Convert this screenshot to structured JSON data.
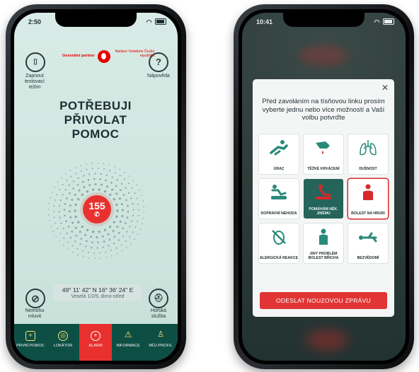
{
  "left_phone": {
    "status_time": "2:50",
    "test_mode_label": "Zapnout testovací režim",
    "help_icon_glyph": "?",
    "help_label": "Nápověda",
    "partner_text": "Generální partner",
    "partner_org": "Nadace Vodafone Česká republika",
    "headline": "POTŘEBUJI PŘIVOLAT POMOC",
    "call_number": "155",
    "coordinates": "49° 11' 42\" N 16° 36' 24\" E",
    "address": "Veselá 1/2/6, Brno-střed",
    "mute_label": "Nemohu mluvit",
    "mountain_label": "Horská služba",
    "tabs": [
      {
        "label": "PRVNÍ POMOC",
        "icon": "first-aid-kit-icon"
      },
      {
        "label": "LOKÁTOR",
        "icon": "locator-icon"
      },
      {
        "label": "ALARM",
        "icon": "alarm-icon"
      },
      {
        "label": "INFORMACE",
        "icon": "warning-icon"
      },
      {
        "label": "MŮJ PROFIL",
        "icon": "profile-icon"
      }
    ],
    "colors": {
      "accent": "#e8312f",
      "tabbar": "#0e4f45"
    }
  },
  "right_phone": {
    "status_time": "10:41",
    "prompt": "Před zavoláním na tísňovou linku prosím vyberte jednu nebo více možností a Vaší volbu potvrďte",
    "options": [
      {
        "label": "ÚRAZ",
        "state": "normal"
      },
      {
        "label": "TĚŽKÉ KRVÁCENÍ",
        "state": "normal"
      },
      {
        "label": "DUŠNOST",
        "state": "normal"
      },
      {
        "label": "DOPRAVNÍ NEHODA",
        "state": "normal"
      },
      {
        "label": "POMÁHÁM NĚK. JINÉMU",
        "state": "selected"
      },
      {
        "label": "BOLEST NA HRUDI",
        "state": "alert"
      },
      {
        "label": "ALERGICKÁ REAKCE",
        "state": "normal"
      },
      {
        "label": "JINÝ PROBLÉM BOLEST BŘICHA",
        "state": "normal"
      },
      {
        "label": "BEZVĚDOMÍ",
        "state": "normal"
      }
    ],
    "send_button": "ODESLAT NOUZOVOU ZPRÁVU",
    "colors": {
      "send": "#e13535",
      "selected": "#25645a"
    }
  }
}
